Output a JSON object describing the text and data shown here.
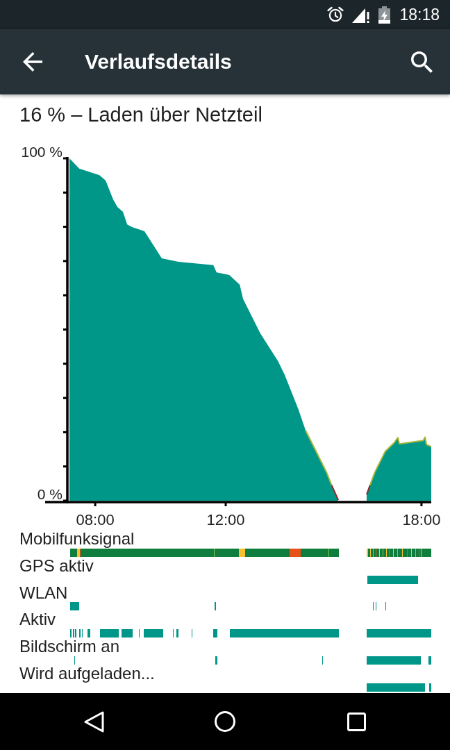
{
  "status_bar": {
    "time": "18:18"
  },
  "app_bar": {
    "title": "Verlaufsdetails"
  },
  "summary": "16 % – Laden über Netzteil",
  "battery_chart": {
    "chart_data": {
      "type": "area",
      "x": [
        7.21,
        7.51,
        8.13,
        8.32,
        8.55,
        8.68,
        8.85,
        8.98,
        9.13,
        9.51,
        10.04,
        10.55,
        11.62,
        11.72,
        12.11,
        12.43,
        12.53,
        13.06,
        13.6,
        13.81,
        14.23,
        14.45,
        14.77,
        15.09,
        15.25,
        15.45,
        15.9,
        16.32,
        16.42,
        16.57,
        16.89,
        17.17,
        17.28,
        17.32,
        18.06,
        18.11,
        18.15,
        18.3
      ],
      "values": [
        100,
        97,
        95.1,
        93.5,
        88,
        85.8,
        84.4,
        80.7,
        79.9,
        78.7,
        70.8,
        69.8,
        68.8,
        66.7,
        65.9,
        63.1,
        59,
        48.9,
        40.8,
        36.7,
        26.6,
        20.5,
        14.4,
        8.3,
        4.5,
        0,
        null,
        1.8,
        4.5,
        8.3,
        14.4,
        17,
        18.5,
        16.6,
        17.6,
        18.7,
        16.4,
        15.8
      ],
      "xlim": [
        7.21,
        18.3
      ],
      "ylim": [
        0,
        100
      ],
      "xticks": [
        {
          "value": 8,
          "label": "08:00"
        },
        {
          "value": 12,
          "label": "12:00"
        },
        {
          "value": 18,
          "label": "18:00"
        }
      ],
      "yticks": [
        {
          "value": 0,
          "label": "0 %"
        },
        {
          "value": 100,
          "label": "100 %"
        }
      ]
    }
  },
  "tracks": [
    {
      "label": "Mobilfunksignal",
      "kind": "signal"
    },
    {
      "label": "GPS aktiv",
      "kind": "bar"
    },
    {
      "label": "WLAN",
      "kind": "bar"
    },
    {
      "label": "Aktiv",
      "kind": "bar"
    },
    {
      "label": "Bildschirm an",
      "kind": "bar"
    },
    {
      "label": "Wird aufgeladen...",
      "kind": "bar"
    }
  ]
}
